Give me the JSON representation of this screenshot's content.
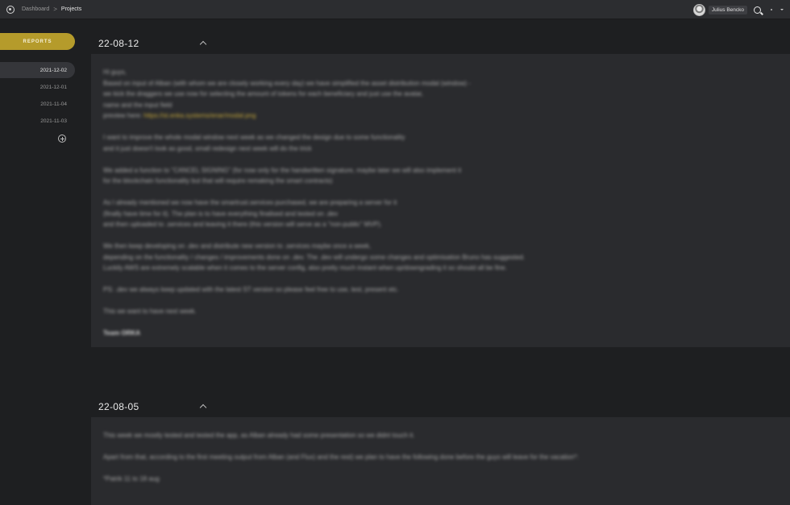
{
  "topbar": {
    "breadcrumb": [
      "Dashboard",
      "Projects"
    ],
    "breadcrumb_sep": ">",
    "user_name": "Julius Bencko"
  },
  "sidebar": {
    "reports_label": "REPORTS",
    "dates": [
      "2021-12-02",
      "2021-12-01",
      "2021-11-04",
      "2021-11-03"
    ],
    "active_index": 0
  },
  "reports": [
    {
      "date": "22-08-12",
      "paragraphs": [
        "Hi guys,\nBased on input of Alban (with whom we are closely working every day) we have simplified the asset distribution modal (window) -\nwe kick the draggers we use now for selecting the amount of tokens for each beneficiary and just use the avatar,\nname and the input field\npreview here: ",
        "I want to improve the whole modal window next week as we changed the design due to some functionality\nand it just doesn't look as good, small redesign next week will do the trick",
        "We added a function to \"CANCEL SIGNING\" (for now only for the handwritten signature, maybe later we will also implement it\nfor the blockchain functionality but that will require remaking the smart contracts)",
        "As I already mentioned we now have the smartrust.services purchased, we are preparing a server for it\n(finally have time for it). The plan is to have everything finalised and tested on .dev\nand then uploaded to .services and leaving it there (this version will serve as a \"non-public\" MVP).",
        "We then keep developing on .dev and distribute new version to .services maybe once a week,\ndepending on the functionality / changes / improvements done on .dev. The .dev will undergo some changes and optimisation Bruno has suggested.\nLuckily AWS are extremely scalable when it comes to the server config, also pretty much instant when up/downgrading it so should all be fine.",
        "PS: .dev we always keep updated with the latest ST version so please feel free to use, test, present etc.",
        "This we want to have next week."
      ],
      "link": "https://st.enka.systems/enar/modal.png",
      "signature": "Team ORKA"
    },
    {
      "date": "22-08-05",
      "paragraphs": [
        "This week we mostly tested and tested the app, as Alban already had some presentation so we didnt touch it.",
        "Apart from that, according to the first meeting output from Alban (and Flux) and the rest) we plan to have the following done before the guys will leave for the vacation*:",
        "*Patrik 11 to 18 aug"
      ]
    }
  ]
}
